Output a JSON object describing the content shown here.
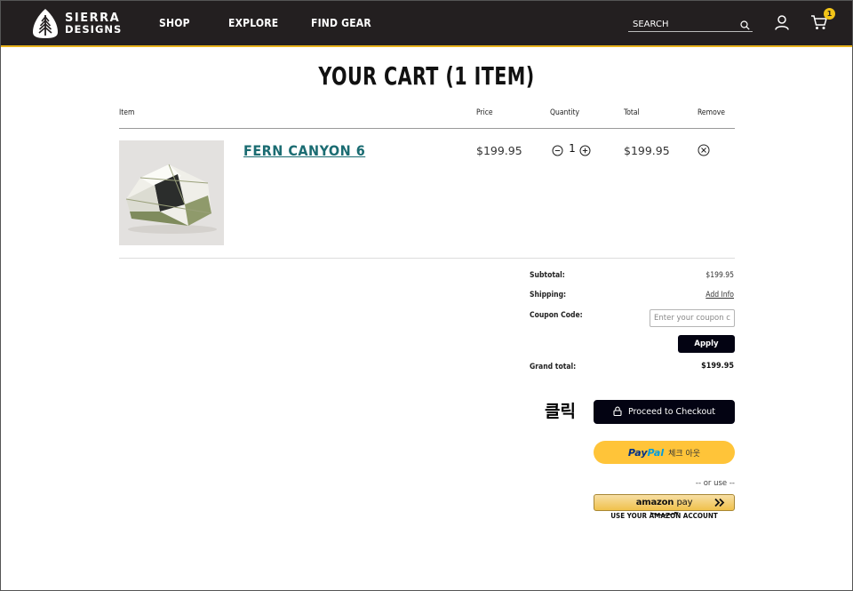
{
  "brand": {
    "line1": "SIERRA",
    "line2": "DESIGNS"
  },
  "nav": {
    "shop": "SHOP",
    "explore": "EXPLORE",
    "find_gear": "FIND GEAR"
  },
  "search": {
    "placeholder": "SEARCH"
  },
  "cart": {
    "badge_count": "1"
  },
  "page_title": "YOUR CART (1 ITEM)",
  "table_headers": {
    "item": "Item",
    "price": "Price",
    "quantity": "Quantity",
    "total": "Total",
    "remove": "Remove"
  },
  "line_item": {
    "name": "FERN CANYON 6",
    "price": "$199.95",
    "quantity": "1",
    "total": "$199.95"
  },
  "summary": {
    "subtotal_label": "Subtotal:",
    "subtotal_value": "$199.95",
    "shipping_label": "Shipping:",
    "shipping_link": "Add Info",
    "coupon_label": "Coupon Code:",
    "coupon_placeholder": "Enter your coupon code",
    "apply_label": "Apply",
    "grand_total_label": "Grand total:",
    "grand_total_value": "$199.95"
  },
  "checkout": {
    "annotation": "클릭",
    "proceed_label": "Proceed to Checkout",
    "paypal_pay": "Pay",
    "paypal_pal": "Pal",
    "paypal_text": "체크 아웃",
    "or_use": "-- or use --",
    "amazon_brand": "amazon",
    "amazon_pay": "pay",
    "amazon_caption": "USE YOUR AMAZON ACCOUNT"
  },
  "colors": {
    "header_bg": "#231f20",
    "accent_yellow": "#e8b21c",
    "link_teal": "#1b6c72",
    "button_dark": "#030312",
    "paypal_yellow": "#ffc439"
  },
  "icons": [
    "tree-logo-icon",
    "search-icon",
    "user-icon",
    "cart-icon",
    "minus-circle-icon",
    "plus-circle-icon",
    "remove-x-icon",
    "lock-icon",
    "amazon-arrow-icon"
  ]
}
